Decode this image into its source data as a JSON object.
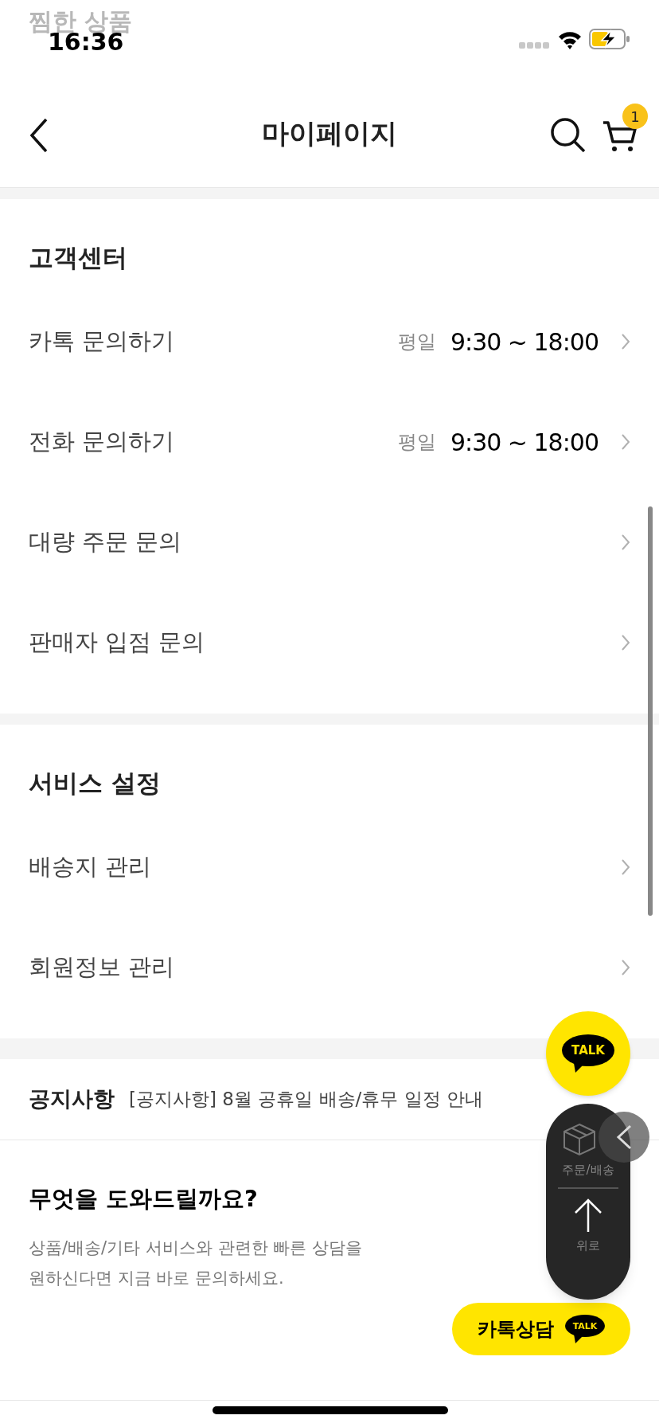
{
  "status_bar": {
    "time": "16:36"
  },
  "scrolled_heading": "찜한 상품",
  "header": {
    "title": "마이페이지",
    "cart_count": "1"
  },
  "sections": [
    {
      "title": "고객센터",
      "rows": [
        {
          "label": "카톡 문의하기",
          "hours_label": "평일",
          "hours": "9:30 ~ 18:00"
        },
        {
          "label": "전화 문의하기",
          "hours_label": "평일",
          "hours": "9:30 ~ 18:00"
        },
        {
          "label": "대량 주문 문의"
        },
        {
          "label": "판매자 입점 문의"
        }
      ]
    },
    {
      "title": "서비스 설정",
      "rows": [
        {
          "label": "배송지 관리"
        },
        {
          "label": "회원정보 관리"
        }
      ]
    }
  ],
  "notice": {
    "label": "공지사항",
    "text": "[공지사항] 8월 공휴일 배송/휴무 일정 안내"
  },
  "help": {
    "title": "무엇을 도와드릴까요?",
    "description_lines": [
      "상품/배송/기타 서비스와 관련한 빠른 상담을",
      "원하신다면 지금 바로 문의하세요."
    ],
    "button": "카톡상담",
    "button_badge": "TALK"
  },
  "floating": {
    "talk_label": "TALK",
    "items": [
      {
        "kind": "box",
        "label": "주문/배송"
      },
      {
        "kind": "up",
        "label": "위로"
      }
    ]
  }
}
